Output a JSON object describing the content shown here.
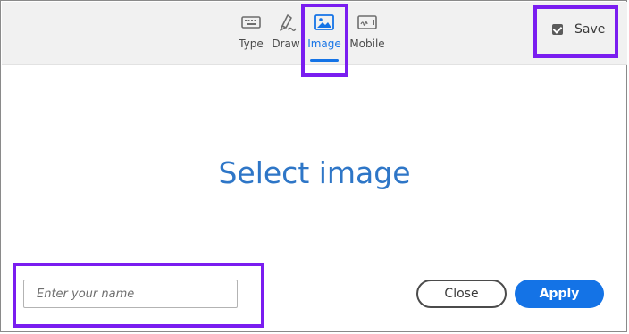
{
  "tabs": [
    {
      "label": "Type",
      "icon": "keyboard-icon"
    },
    {
      "label": "Draw",
      "icon": "pen-icon"
    },
    {
      "label": "Image",
      "icon": "image-icon",
      "active": true
    },
    {
      "label": "Mobile",
      "icon": "mobile-signature-icon"
    }
  ],
  "save": {
    "label": "Save",
    "checked": true
  },
  "main": {
    "prompt": "Select image"
  },
  "footer": {
    "name_placeholder": "Enter your name",
    "close_label": "Close",
    "apply_label": "Apply"
  },
  "colors": {
    "accent": "#1473e6",
    "highlight": "#7a1df0",
    "prompt": "#2e76c7"
  }
}
